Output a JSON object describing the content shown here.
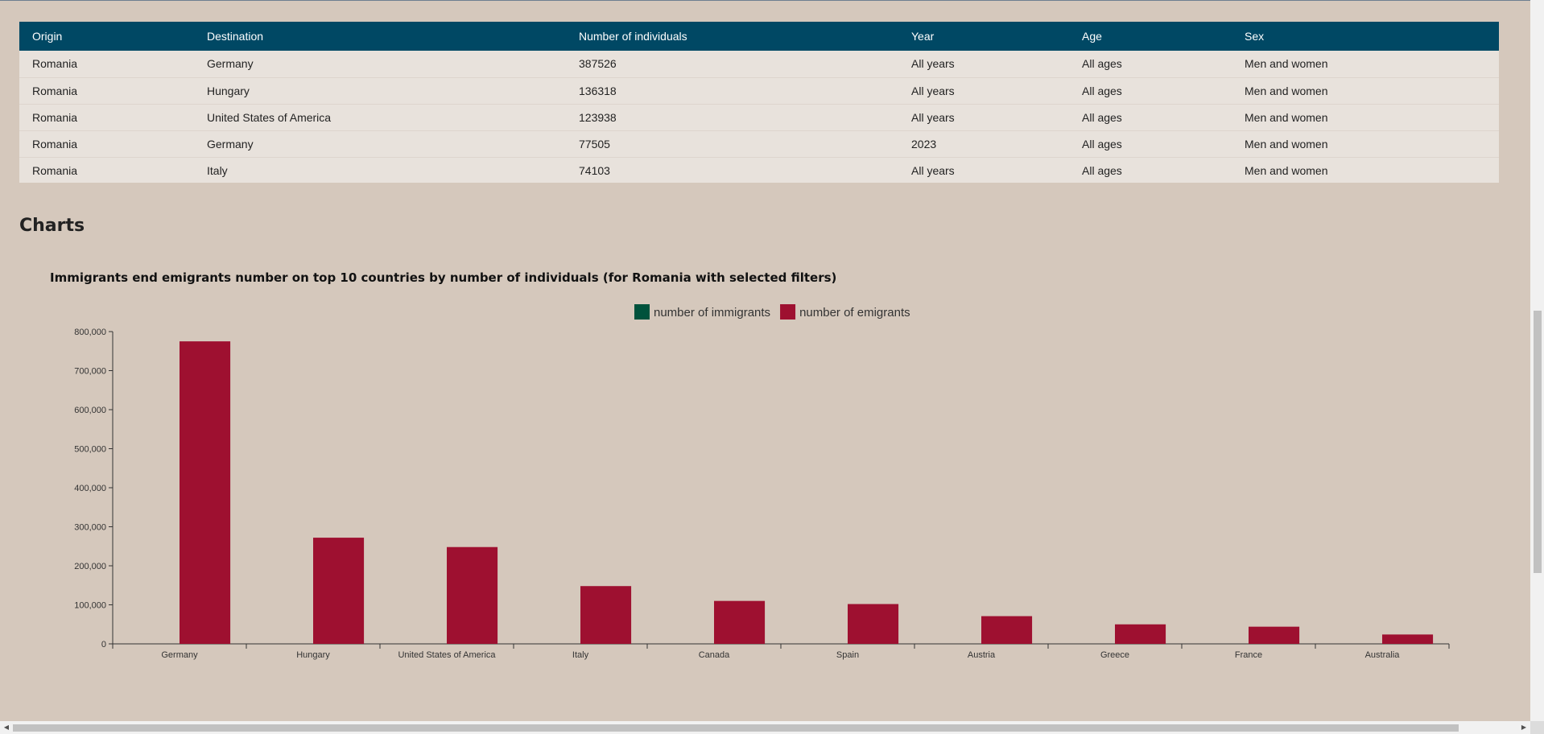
{
  "table": {
    "columns": [
      "Origin",
      "Destination",
      "Number of individuals",
      "Year",
      "Age",
      "Sex"
    ],
    "rows": [
      [
        "Romania",
        "Germany",
        "387526",
        "All years",
        "All ages",
        "Men and women"
      ],
      [
        "Romania",
        "Hungary",
        "136318",
        "All years",
        "All ages",
        "Men and women"
      ],
      [
        "Romania",
        "United States of America",
        "123938",
        "All years",
        "All ages",
        "Men and women"
      ],
      [
        "Romania",
        "Germany",
        "77505",
        "2023",
        "All ages",
        "Men and women"
      ],
      [
        "Romania",
        "Italy",
        "74103",
        "All years",
        "All ages",
        "Men and women"
      ]
    ]
  },
  "section_title": "Charts",
  "chart_data": {
    "type": "bar",
    "title": "Immigrants end emigrants number on top 10 countries by number of individuals (for Romania with selected filters)",
    "categories": [
      "Germany",
      "Hungary",
      "United States of America",
      "Italy",
      "Canada",
      "Spain",
      "Austria",
      "Greece",
      "France",
      "Australia"
    ],
    "series": [
      {
        "name": "number of immigrants",
        "color": "#00523c",
        "values": [
          0,
          0,
          0,
          0,
          0,
          0,
          0,
          0,
          0,
          0
        ]
      },
      {
        "name": "number of emigrants",
        "color": "#9e1030",
        "values": [
          775000,
          272000,
          248000,
          148000,
          110000,
          102000,
          71000,
          50000,
          44000,
          24000
        ]
      }
    ],
    "ylim": [
      0,
      800000
    ],
    "yticks": [
      0,
      100000,
      200000,
      300000,
      400000,
      500000,
      600000,
      700000,
      800000
    ],
    "legend_position": "top-center",
    "grid": false
  },
  "icons": {
    "scroll_up": "▲",
    "scroll_down": "▼",
    "scroll_left": "◀",
    "scroll_right": "▶"
  }
}
